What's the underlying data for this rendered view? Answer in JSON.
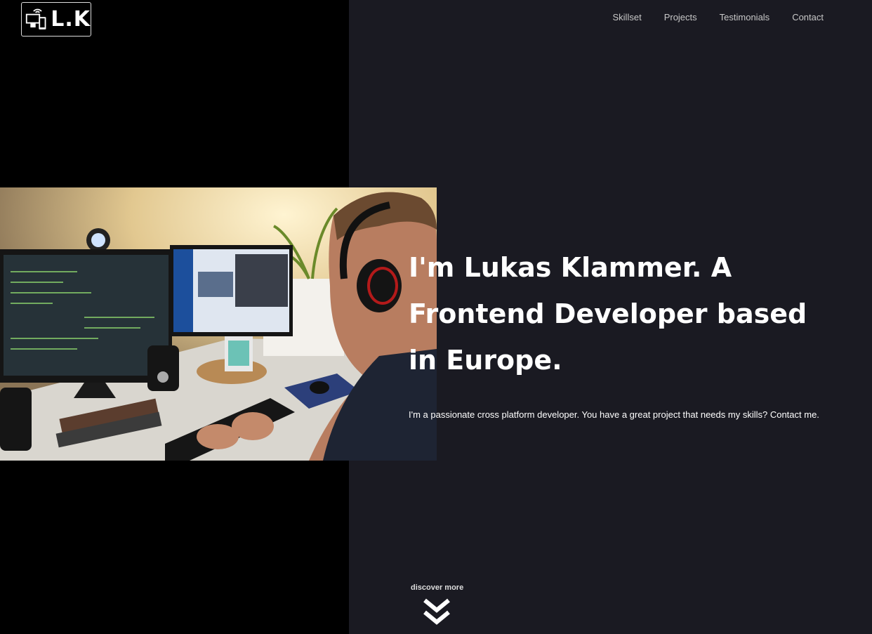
{
  "logo": {
    "text": "L.K",
    "icon": "devices-icon"
  },
  "nav": {
    "items": [
      "Skillset",
      "Projects",
      "Testimonials",
      "Contact"
    ]
  },
  "hero": {
    "title": "I'm Lukas Klammer. A Frontend Developer based in Europe.",
    "subtitle": "I'm a passionate cross platform developer. You have a great project that needs my skills? Contact me."
  },
  "discover": {
    "label": "discover more",
    "icon": "double-chevron-down-icon"
  },
  "photo": {
    "description_icon": "developer-at-desk-photo"
  },
  "colors": {
    "left_bg": "#000000",
    "right_bg": "#1a1a22",
    "text": "#ffffff",
    "nav": "#c8c8c8"
  }
}
